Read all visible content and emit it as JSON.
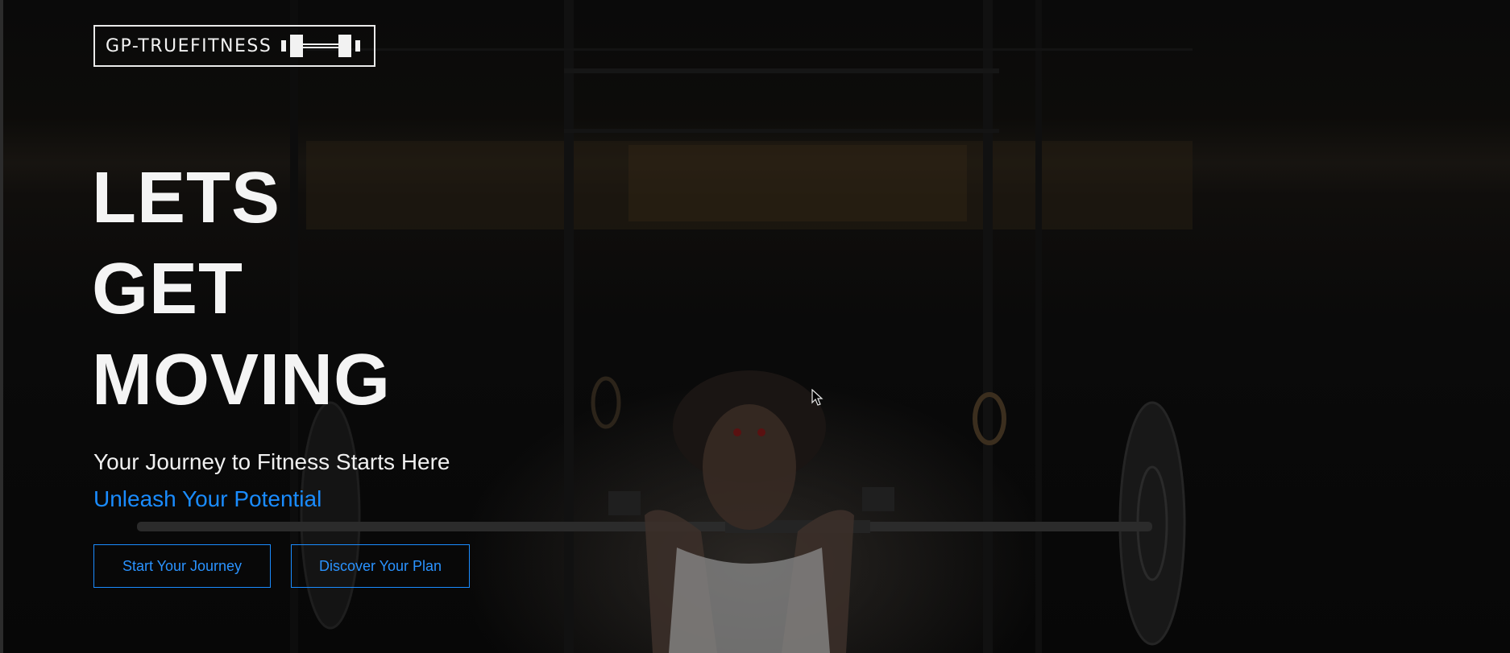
{
  "logo": {
    "text": "GP-TRUEFITNESS",
    "icon": "barbell-icon"
  },
  "hero": {
    "headline_lines": [
      "LETS",
      "GET",
      "MOVING"
    ],
    "subtitle": "Your Journey to Fitness Starts Here",
    "tagline": "Unleash Your Potential"
  },
  "buttons": {
    "start_label": "Start Your Journey",
    "plan_label": "Discover Your Plan"
  },
  "background": {
    "description_icon": "weightlifter-photo"
  },
  "colors": {
    "accent": "#1a8cff",
    "text": "#f4f4f4",
    "background": "#000000"
  }
}
